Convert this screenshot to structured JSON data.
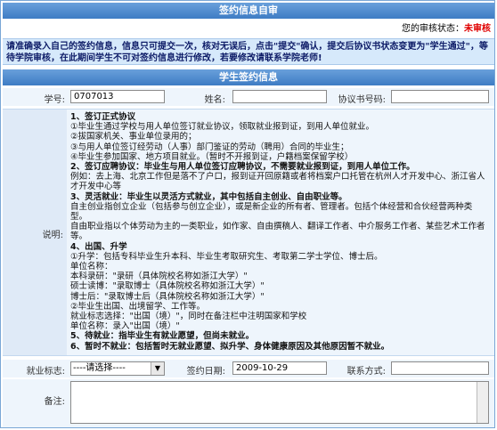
{
  "header": {
    "title": "签约信息自审"
  },
  "status": {
    "label": "您的审核状态：",
    "value": "未审核"
  },
  "notice": "请准确录入自己的签约信息，信息只可提交一次，核对无误后，点击\"提交\"确认，提交后协议书状态变更为\"学生通过\"，等待学院审核，在此期间学生不可对签约信息进行修改，若要修改请联系学院老师!",
  "section": {
    "title": "学生签约信息"
  },
  "fields": {
    "student_id_label": "学号:",
    "student_id_value": "0707013",
    "name_label": "姓名:",
    "name_value": "",
    "agreement_no_label": "协议书号码:",
    "agreement_no_value": "",
    "desc_label": "说明:",
    "employment_flag_label": "就业标志:",
    "employment_flag_value": "----请选择----",
    "sign_date_label": "签约日期:",
    "sign_date_value": "2009-10-29",
    "contact_label": "联系方式:",
    "contact_value": "",
    "remark_label": "备注:"
  },
  "description": [
    {
      "t": "1、签订正式协议",
      "h": true
    },
    {
      "t": "①毕业生通过学校与用人单位签订就业协议，领取就业报到证，到用人单位就业。"
    },
    {
      "t": "②拔国家机关、事业单位录用的；"
    },
    {
      "t": "③与用人单位签订经劳动（人事）部门鉴证的劳动（聘用）合同的毕业生；"
    },
    {
      "t": "④毕业生参加国家、地方项目就业。（暂时不开报到证，户籍档案保留学校）"
    },
    {
      "t": "2、签订应聘协议：毕业生与用人单位签订应聘协议，不需要就业报到证，到用人单位工作。",
      "h": true
    },
    {
      "t": "例如：去上海、北京工作但是落不了户口，报到证开回原籍或者将档案户口托管在杭州人才开发中心、浙江省人才开发中心等"
    },
    {
      "t": "3、灵活就业：毕业生以灵活方式就业，其中包括自主创业、自由职业等。",
      "h": true
    },
    {
      "t": "自主创业指创立企业（包括参与创立企业），或是新企业的所有者、管理者。包括个体经营和合伙经营两种类型。"
    },
    {
      "t": "自由职业指以个体劳动为主的一类职业，如作家、自由撰稿人、翻译工作者、中介服务工作者、某些艺术工作者等。"
    },
    {
      "t": "4、出国、升学",
      "h": true
    },
    {
      "t": "①升学：包括专科毕业生升本科、毕业生考取研究生、考取第二学士学位、博士后。"
    },
    {
      "t": "单位名称："
    },
    {
      "t": "本科录研：\"录研（具体院校名称如浙江大学）\""
    },
    {
      "t": "硕士读博：\"录取博士（具体院校名称如浙江大学）\""
    },
    {
      "t": "博士后：\"录取博士后（具体院校名称如浙江大学）\""
    },
    {
      "t": "②毕业生出国、出境留学、工作等。"
    },
    {
      "t": "就业标志选择：\"出国（境）\"，同时在备注栏中注明国家和学校"
    },
    {
      "t": "单位名称：录入\"出国（境）\""
    },
    {
      "t": "5、待就业：指毕业生有就业愿望，但尚未就业。",
      "h": true
    },
    {
      "t": "6、暂时不就业：包括暂时无就业愿望、拟升学、身体健康原因及其他原因暂不就业。",
      "h": true
    }
  ]
}
